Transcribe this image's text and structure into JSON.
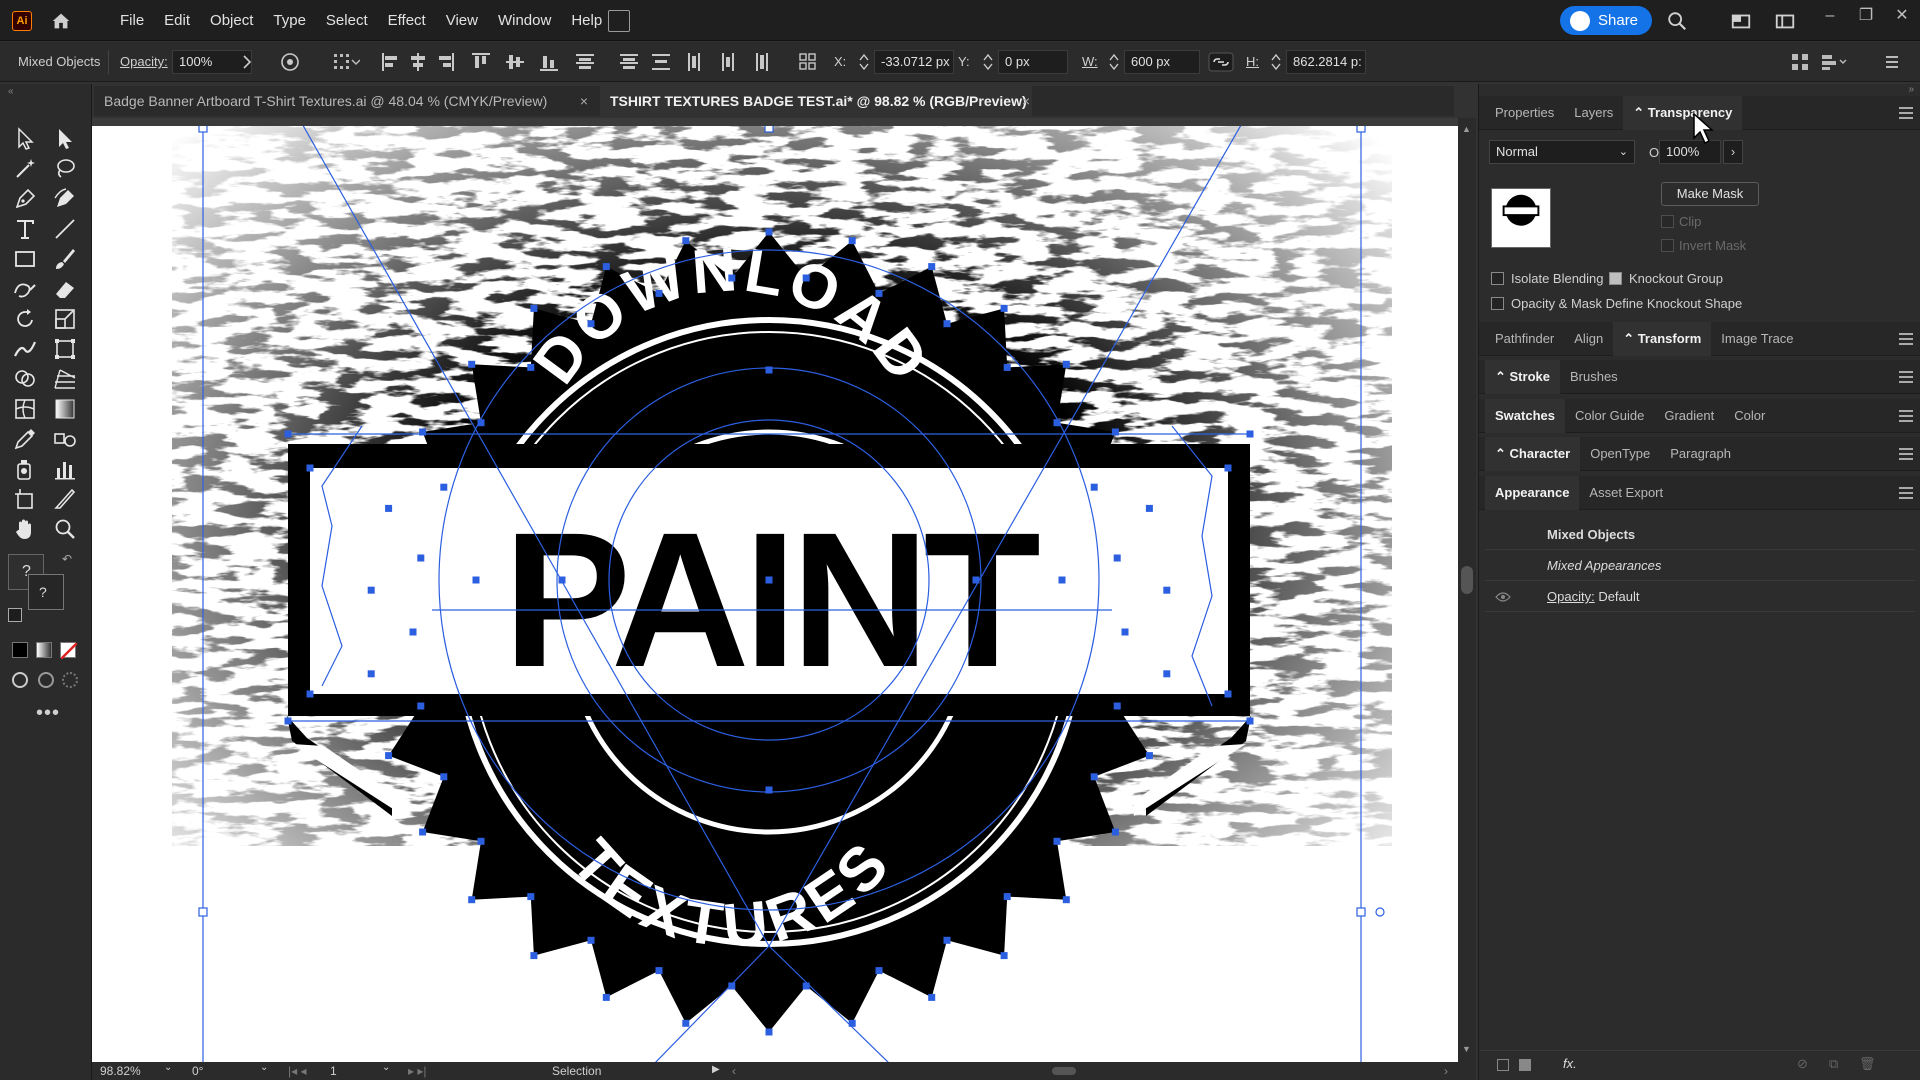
{
  "menubar": {
    "logo": "Ai",
    "items": [
      "File",
      "Edit",
      "Object",
      "Type",
      "Select",
      "Effect",
      "View",
      "Window",
      "Help"
    ],
    "share_label": "Share"
  },
  "control_bar": {
    "selection_label": "Mixed Objects",
    "opacity_label": "Opacity:",
    "opacity_value": "100%",
    "x_label": "X:",
    "x_value": "-33.0712 px",
    "y_label": "Y:",
    "y_value": "0 px",
    "w_label": "W:",
    "w_value": "600 px",
    "h_label": "H:",
    "h_value": "862.2814 p:"
  },
  "documents": {
    "tabs": [
      {
        "title": "Badge Banner Artboard T-Shirt Textures.ai @ 48.04 % (CMYK/Preview)",
        "active": false
      },
      {
        "title": "TSHIRT TEXTURES BADGE TEST.ai* @ 98.82 % (RGB/Preview)",
        "active": true
      }
    ],
    "close_glyph": "×"
  },
  "artwork": {
    "top_arc_text": "DOWNLOAD",
    "banner_text": "PAINT",
    "bottom_arc_text": "TEXTURES"
  },
  "status_bar": {
    "zoom": "98.82%",
    "rotation": "0°",
    "artboard_number": "1",
    "tool": "Selection"
  },
  "panels": {
    "group1_tabs": [
      "Properties",
      "Layers",
      "Transparency"
    ],
    "transparency": {
      "blend_mode": "Normal",
      "opacity_label": "Opacity:",
      "opacity_value": "100%",
      "make_mask": "Make Mask",
      "clip": "Clip",
      "invert_mask": "Invert Mask",
      "isolate_blending": "Isolate Blending",
      "knockout_group": "Knockout Group",
      "opacity_mask_knockout": "Opacity & Mask Define Knockout Shape"
    },
    "group2_tabs": [
      "Pathfinder",
      "Align",
      "Transform",
      "Image Trace"
    ],
    "group3_tabs": [
      "Stroke",
      "Brushes"
    ],
    "group4_tabs": [
      "Swatches",
      "Color Guide",
      "Gradient",
      "Color"
    ],
    "group5_tabs": [
      "Character",
      "OpenType",
      "Paragraph"
    ],
    "group6_tabs": [
      "Appearance",
      "Asset Export"
    ],
    "appearance": {
      "title": "Mixed Objects",
      "subtitle": "Mixed Appearances",
      "opacity_label": "Opacity:",
      "opacity_value": "Default"
    }
  },
  "colors": {
    "accent": "#1473e6",
    "selection": "#2c5fe0",
    "bg": "#323232"
  }
}
